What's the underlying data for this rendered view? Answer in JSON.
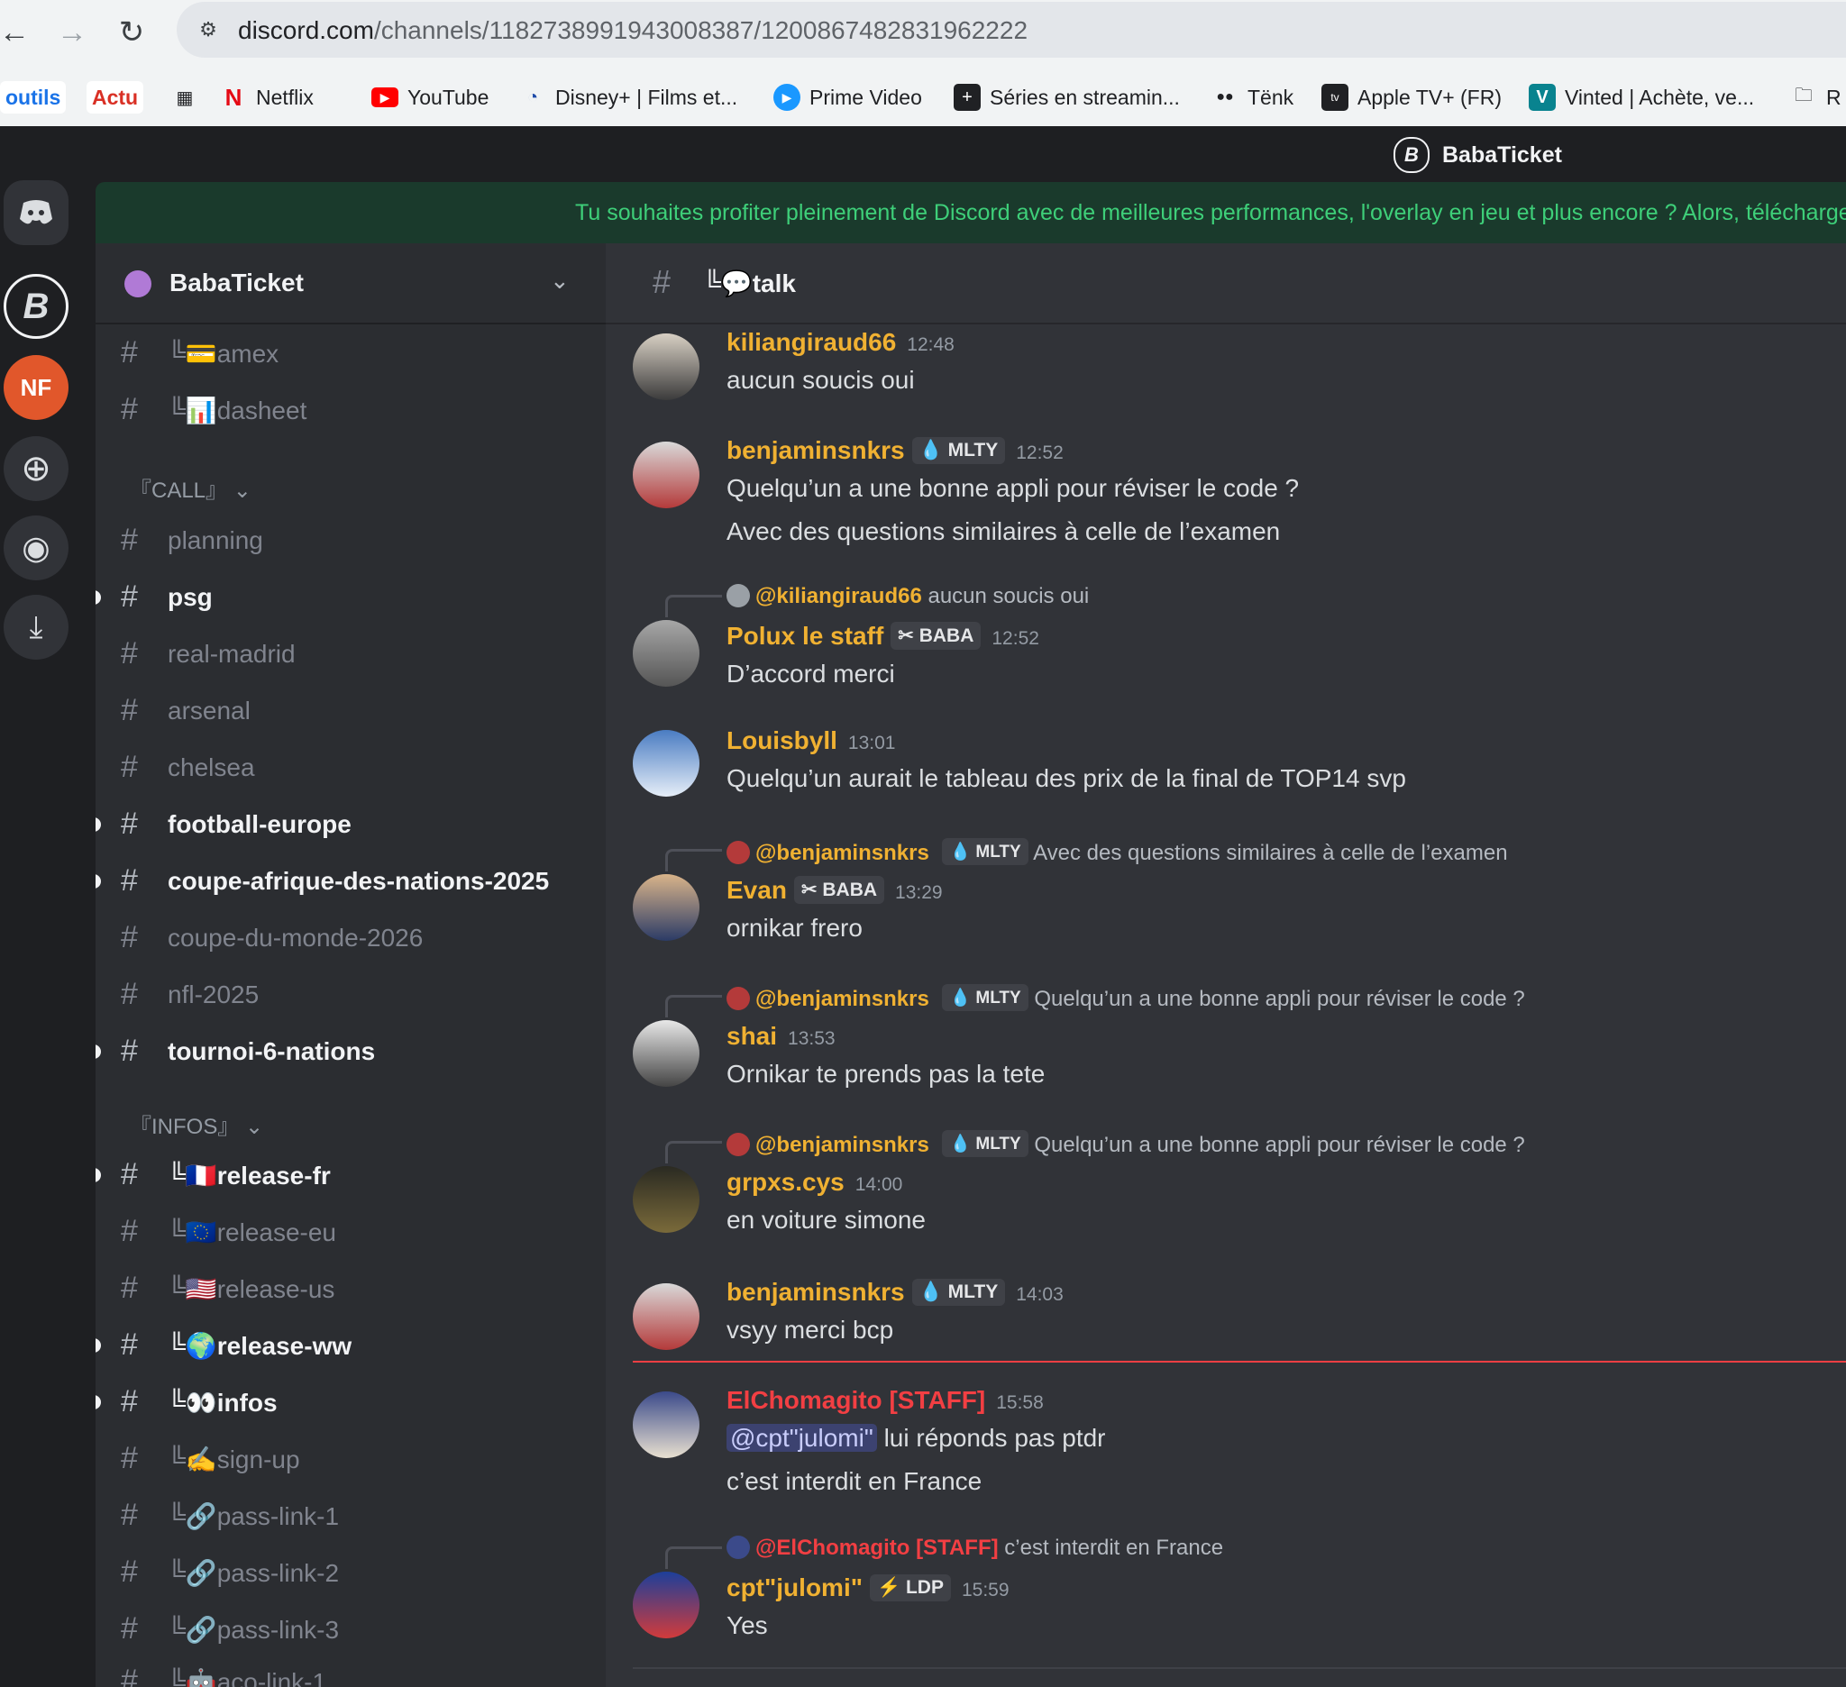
{
  "browser": {
    "url_domain": "discord.com",
    "url_path": "/channels/1182738991943008387/1200867482831962222",
    "bookmarks": [
      {
        "label": "outils",
        "icon": "folder-pill"
      },
      {
        "label": "Actu",
        "icon": "folder-pill"
      },
      {
        "label": "",
        "icon": "apps-grid-icon"
      },
      {
        "label": "Netflix",
        "icon": "netflix-icon"
      },
      {
        "label": "YouTube",
        "icon": "youtube-icon"
      },
      {
        "label": "Disney+ | Films et...",
        "icon": "disney-icon"
      },
      {
        "label": "Prime Video",
        "icon": "prime-video-icon"
      },
      {
        "label": "Séries en streamin...",
        "icon": "plus-square-icon"
      },
      {
        "label": "Tënk",
        "icon": "dots-icon"
      },
      {
        "label": "Apple TV+ (FR)",
        "icon": "apple-tv-icon"
      },
      {
        "label": "Vinted | Achète, ve...",
        "icon": "vinted-icon"
      },
      {
        "label": "R",
        "icon": "folder-icon"
      }
    ]
  },
  "app": {
    "title": "BabaTicket",
    "notice": "Tu souhaites profiter pleinement de Discord avec de meilleures performances, l'overlay en jeu et plus encore ? Alors, télécharge"
  },
  "sidebar": {
    "guild_name": "BabaTicket",
    "top_channels": [
      {
        "label": "╚💳amex",
        "unread": false
      },
      {
        "label": "╚📊dasheet",
        "unread": false
      }
    ],
    "category_call": "『CALL』",
    "call_channels": [
      {
        "label": "planning",
        "unread": false
      },
      {
        "label": "psg",
        "unread": true
      },
      {
        "label": "real-madrid",
        "unread": false
      },
      {
        "label": "arsenal",
        "unread": false
      },
      {
        "label": "chelsea",
        "unread": false
      },
      {
        "label": "football-europe",
        "unread": true
      },
      {
        "label": "coupe-afrique-des-nations-2025",
        "unread": true
      },
      {
        "label": "coupe-du-monde-2026",
        "unread": false
      },
      {
        "label": "nfl-2025",
        "unread": false
      },
      {
        "label": "tournoi-6-nations",
        "unread": true
      }
    ],
    "category_infos": "『INFOS』",
    "info_channels": [
      {
        "label": "╚🇫🇷release-fr",
        "unread": true
      },
      {
        "label": "╚🇪🇺release-eu",
        "unread": false
      },
      {
        "label": "╚🇺🇸release-us",
        "unread": false
      },
      {
        "label": "╚🌍release-ww",
        "unread": true
      },
      {
        "label": "╚👀infos",
        "unread": true
      },
      {
        "label": "╚✍sign-up",
        "unread": false
      },
      {
        "label": "╚🔗pass-link-1",
        "unread": false
      },
      {
        "label": "╚🔗pass-link-2",
        "unread": false
      },
      {
        "label": "╚🔗pass-link-3",
        "unread": false
      },
      {
        "label": "╚🤖aco-link-1",
        "unread": false
      }
    ]
  },
  "chat": {
    "channel_name": "╚💬talk",
    "messages": [
      {
        "user": "kiliangiraud66",
        "color": "#f0b132",
        "tag": "",
        "time": "12:48",
        "lines": [
          "aucun soucis oui"
        ],
        "reply": null
      },
      {
        "user": "benjaminsnkrs",
        "color": "#f0b132",
        "tag": "MLTY",
        "time": "12:52",
        "lines": [
          "Quelqu’un a une bonne appli pour réviser le code ?",
          "Avec des questions similaires à celle de l’examen"
        ],
        "reply": null
      },
      {
        "user": "Polux le staff",
        "color": "#f0b132",
        "tag": "BABA",
        "time": "12:52",
        "lines": [
          "D’accord merci"
        ],
        "reply": {
          "user": "@kiliangiraud66",
          "tag": "",
          "text": "aucun soucis oui",
          "color": "#f0b132"
        }
      },
      {
        "user": "Louisbyll",
        "color": "#f0b132",
        "tag": "",
        "time": "13:01",
        "lines": [
          "Quelqu’un aurait le tableau des prix de la final de TOP14 svp"
        ],
        "reply": null
      },
      {
        "user": "Evan",
        "color": "#f0b132",
        "tag": "BABA",
        "time": "13:29",
        "lines": [
          "ornikar frero"
        ],
        "reply": {
          "user": "@benjaminsnkrs",
          "tag": "MLTY",
          "text": "Avec des questions similaires à celle de l’examen",
          "color": "#f0b132"
        }
      },
      {
        "user": "shai",
        "color": "#f0b132",
        "tag": "",
        "time": "13:53",
        "lines": [
          "Ornikar te prends pas la tete"
        ],
        "reply": {
          "user": "@benjaminsnkrs",
          "tag": "MLTY",
          "text": "Quelqu’un a une bonne appli pour réviser le code ?",
          "color": "#f0b132"
        }
      },
      {
        "user": "grpxs.cys",
        "color": "#f0b132",
        "tag": "",
        "time": "14:00",
        "lines": [
          "en voiture simone"
        ],
        "reply": {
          "user": "@benjaminsnkrs",
          "tag": "MLTY",
          "text": "Quelqu’un a une bonne appli pour réviser le code ?",
          "color": "#f0b132"
        }
      },
      {
        "user": "benjaminsnkrs",
        "color": "#f0b132",
        "tag": "MLTY",
        "time": "14:03",
        "lines": [
          "vsyy merci bcp"
        ],
        "reply": null
      },
      {
        "user": "ElChomagito [STAFF]",
        "color": "#f23f43",
        "tag": "",
        "time": "15:58",
        "mention": "@cpt\"julomi\"",
        "lines": [
          "lui réponds pas ptdr",
          "c’est interdit en France"
        ],
        "reply": null
      },
      {
        "user": "cpt\"julomi\"",
        "color": "#f0b132",
        "tag": "LDP",
        "time": "15:59",
        "lines": [
          "Yes"
        ],
        "reply": {
          "user": "@ElChomagito [STAFF]",
          "tag": "",
          "text": "c’est interdit en France",
          "color": "#f23f43"
        }
      }
    ]
  }
}
